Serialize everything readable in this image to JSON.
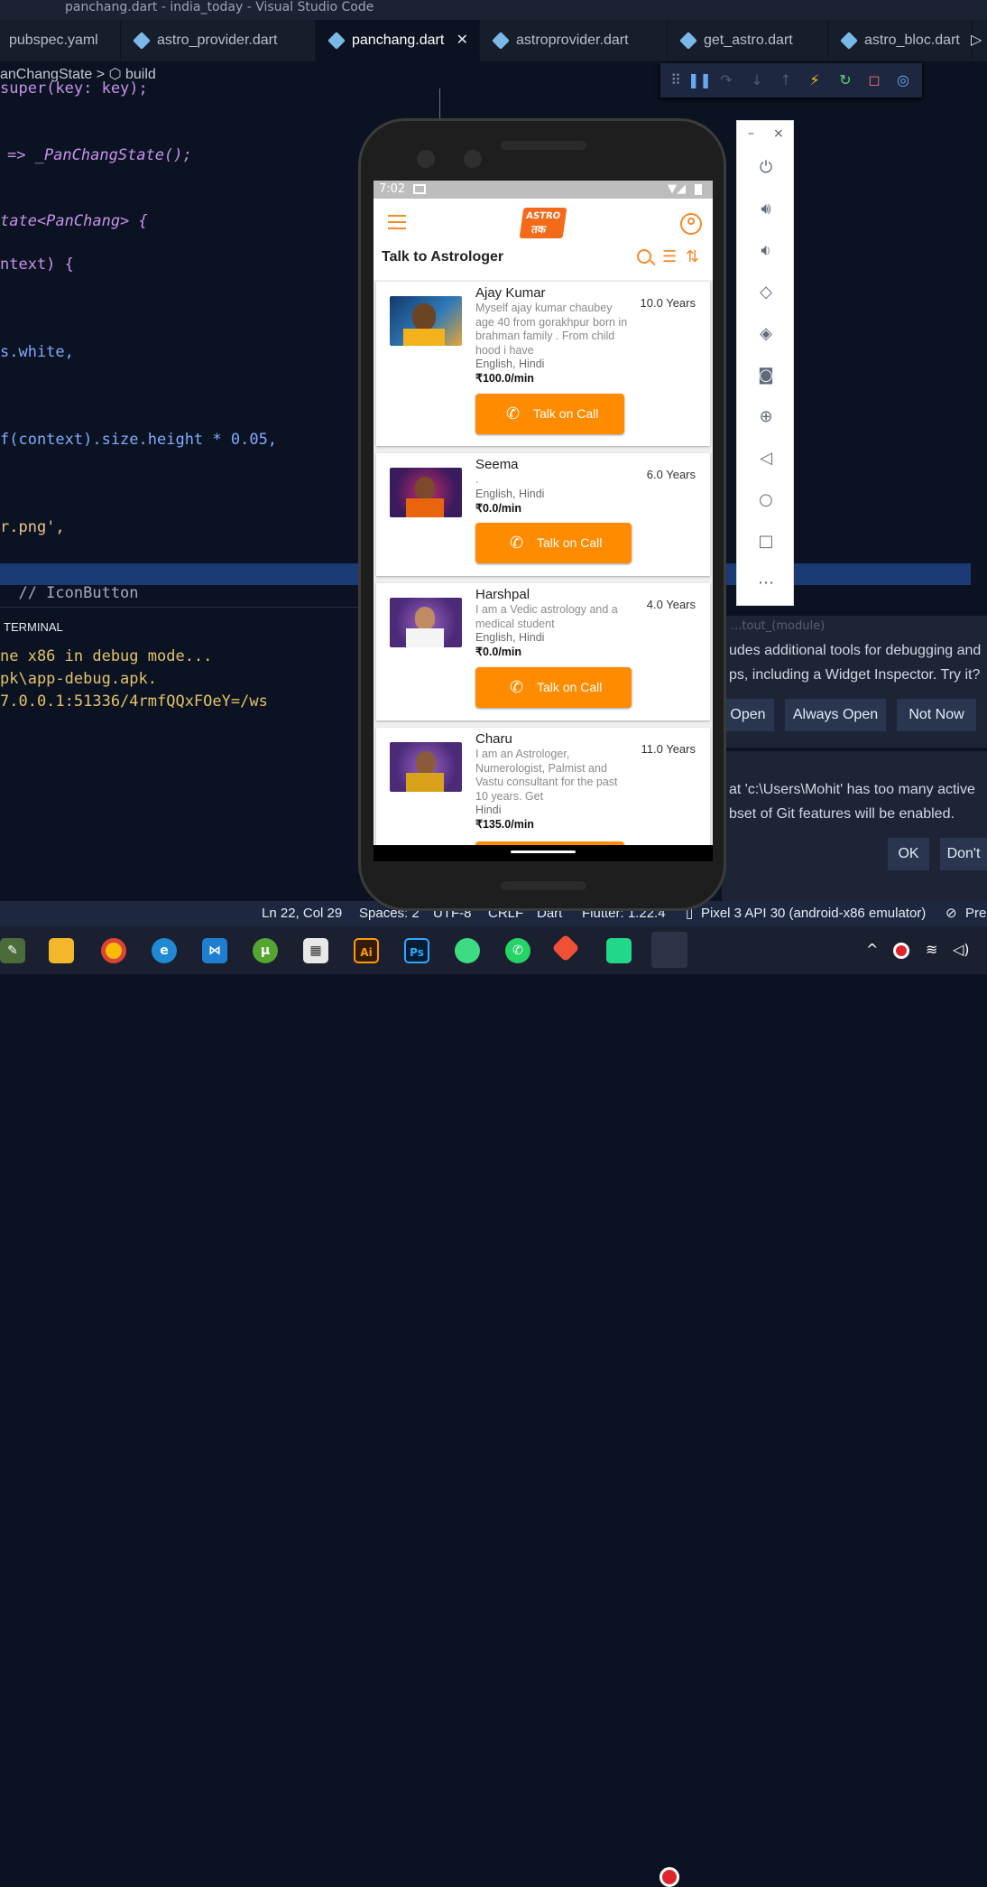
{
  "window": {
    "title": "panchang.dart - india_today - Visual Studio Code"
  },
  "tabs": [
    {
      "label": "pubspec.yaml"
    },
    {
      "label": "astro_provider.dart"
    },
    {
      "label": "panchang.dart",
      "active": true
    },
    {
      "label": "astroprovider.dart"
    },
    {
      "label": "get_astro.dart"
    },
    {
      "label": "astro_bloc.dart"
    }
  ],
  "breadcrumb": {
    "class": "anChangState",
    "sep": ">",
    "method": "build"
  },
  "code_lines": [
    "super(key: key);",
    "=> _PanChangState();",
    "tate<PanChang> {",
    "ntext) {",
    "s.white,",
    "f(context).size.height * 0.05,",
    "r.png',",
    "  // IconButton"
  ],
  "terminal": {
    "tab_label": "TERMINAL",
    "lines": [
      "ne x86 in debug mode...",
      "pk\\app-debug.apk.",
      "7.0.0.1:51336/4rmfQQxFOeY=/ws"
    ],
    "faded_text": "...tout_(module)"
  },
  "notifications": {
    "devtools": {
      "line1": "udes additional tools for debugging and",
      "line2": "ps, including a Widget Inspector. Try it?",
      "open_label": "Open",
      "always_open_label": "Always Open",
      "not_now_label": "Not Now"
    },
    "git": {
      "line1": "at 'c:\\Users\\Mohit' has too many active",
      "line2": "bset of Git features will be enabled.",
      "ok_label": "OK",
      "dont_label": "Don't"
    }
  },
  "statusbar": {
    "position": "Ln 22, Col 29",
    "spaces": "Spaces: 2",
    "encoding": "UTF-8",
    "eol": "CRLF",
    "language": "Dart",
    "flutter": "Flutter: 1.22.4",
    "device": "Pixel 3 API 30 (android-x86 emulator)",
    "prettier": "Pre"
  },
  "app": {
    "status_time": "7:02",
    "logo_top": "ASTRO",
    "logo_bottom": "तक",
    "page_title": "Talk to Astrologer",
    "astrologers": [
      {
        "name": "Ajay Kumar",
        "description": "Myself ajay kumar chaubey age 40 from gorakhpur born in brahman family . From child hood  i have",
        "languages": "English, Hindi",
        "price": "₹100.0/min",
        "experience": "10.0 Years",
        "button": "Talk on Call"
      },
      {
        "name": "Seema",
        "description": ".",
        "languages": "English, Hindi",
        "price": "₹0.0/min",
        "experience": "6.0 Years",
        "button": "Talk on Call"
      },
      {
        "name": "Harshpal",
        "description": "I am a Vedic astrology and a medical student",
        "languages": "English, Hindi",
        "price": "₹0.0/min",
        "experience": "4.0 Years",
        "button": "Talk on Call"
      },
      {
        "name": "Charu",
        "description": "I am an Astrologer, Numerologist, Palmist and Vastu consultant for the past 10 years. Get",
        "languages": "Hindi",
        "price": "₹135.0/min",
        "experience": "11.0 Years",
        "button": ""
      }
    ]
  },
  "colors": {
    "accent": "#ff8c00",
    "vscode_bg": "#0b1322",
    "statusbar": "#1e2740"
  }
}
